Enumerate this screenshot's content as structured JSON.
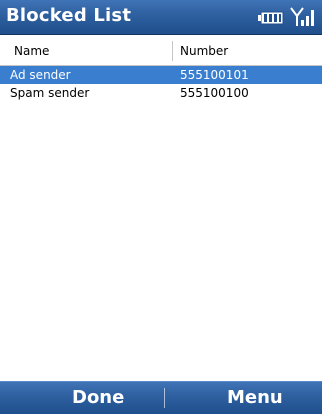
{
  "title_bar": {
    "title": "Blocked List",
    "icons": [
      "battery-icon",
      "signal-strength-icon"
    ]
  },
  "list": {
    "columns": [
      "Name",
      "Number"
    ],
    "rows": [
      {
        "name": "Ad sender",
        "number": "555100101",
        "selected": true
      },
      {
        "name": "Spam sender",
        "number": "555100100",
        "selected": false
      }
    ]
  },
  "softkeys": {
    "left": "Done",
    "right": "Menu"
  },
  "colors": {
    "titlebar": "#2e5f9f",
    "selection": "#3a7fcf",
    "softkeys": "#2e5f9f"
  }
}
